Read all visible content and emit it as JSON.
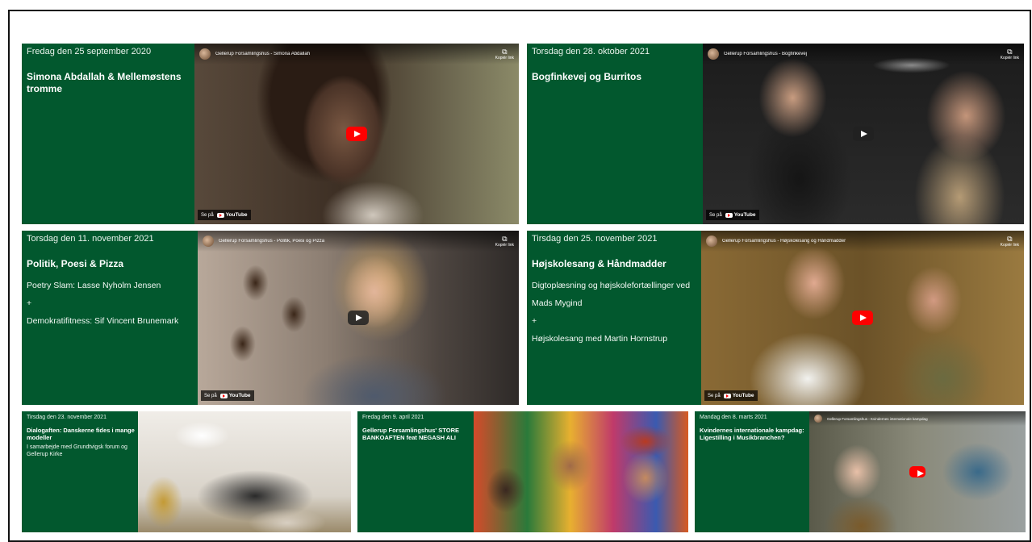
{
  "colors": {
    "card_bg": "#02582e",
    "play_red": "#ff0000"
  },
  "video_ui": {
    "copy_label": "Kopiér link",
    "watch_on": "Se på",
    "brand": "YouTube"
  },
  "events": [
    {
      "date": "Fredag den  25 september 2020",
      "title": "Simona Abdallah & Mellemøstens tromme",
      "body": [],
      "video_title": "Gellerup Forsamlingshus - Simona Abdallah",
      "play": "red"
    },
    {
      "date": "Torsdag den 28. oktober 2021",
      "title": "Bogfinkevej og Burritos",
      "body": [],
      "video_title": "Gellerup Forsamlingshus - Bogfinkevej",
      "play": "dark"
    },
    {
      "date": "Torsdag den 11. november 2021",
      "title": "Politik, Poesi & Pizza",
      "body": [
        "Poetry Slam: Lasse Nyholm Jensen",
        "+",
        "Demokratifitness: Sif Vincent Brunemark"
      ],
      "video_title": "Gellerup Forsamlingshus - Politik, Poesi og Pizza",
      "play": "dark"
    },
    {
      "date": "Tirsdag den 25. november 2021",
      "title": "Højskolesang & Håndmadder",
      "body": [
        "Digtoplæsning og højskolefortællinger ved Mads Mygind",
        "+",
        "Højskolesang med Martin Hornstrup"
      ],
      "video_title": "Gellerup Forsamlingshus - Højskolesang og Håndmadder",
      "play": "red"
    },
    {
      "date": "Tirsdag den 23. november 2021",
      "title": "Dialogaften: Danskerne fides i mange modeller",
      "body": [
        "I samarbejde med Grundtvigsk forum og Gellerup Kirke"
      ],
      "video_title": "",
      "play": "none"
    },
    {
      "date": "Fredag den 9. april 2021",
      "title": "Gellerup Forsamlingshus' STORE BANKOAFTEN feat NEGASH ALI",
      "body": [],
      "video_title": "",
      "play": "none"
    },
    {
      "date": "Mandag den 8. marts 2021",
      "title": "Kvindernes internationale kampdag: Ligestilling i Musikbranchen?",
      "body": [],
      "video_title": "Gellerup Forsamlingshus - Kvindernes internationale kampdag",
      "play": "red"
    }
  ]
}
